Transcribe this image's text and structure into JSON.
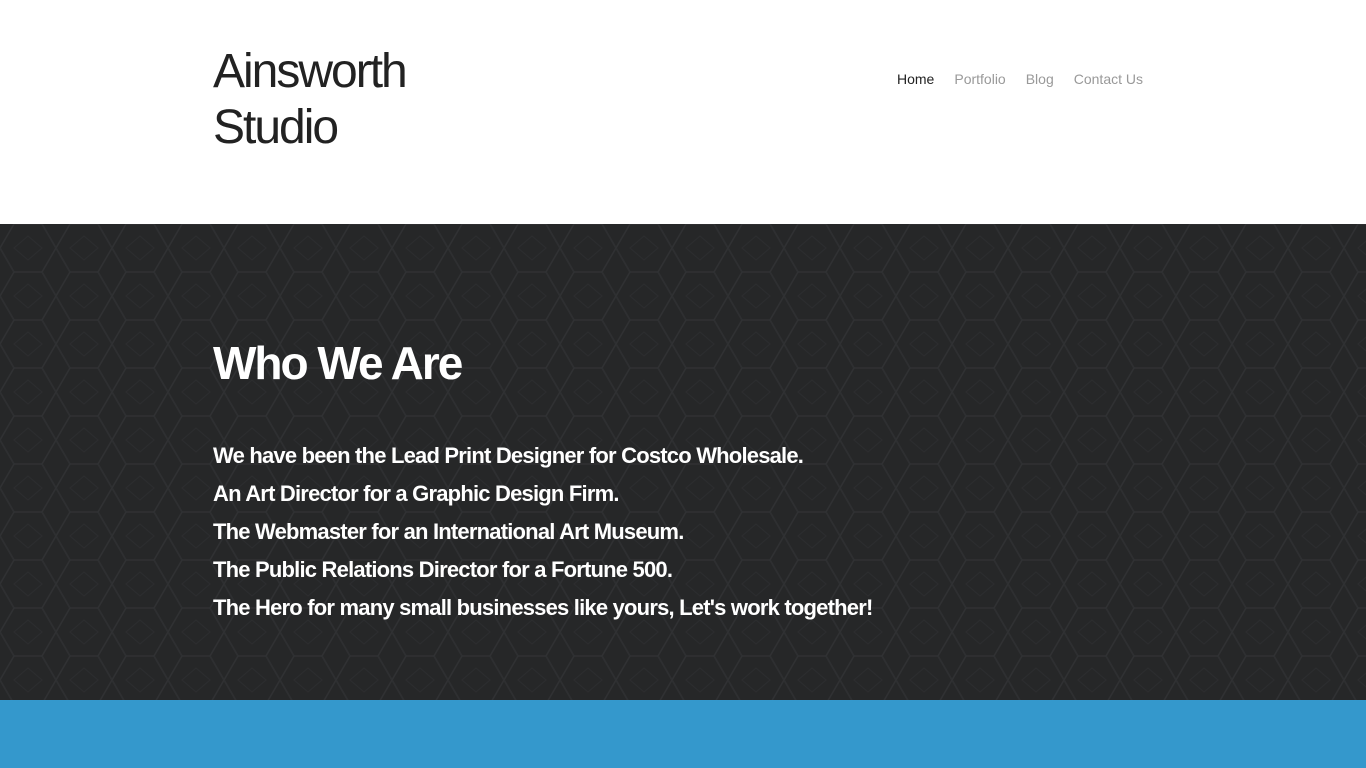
{
  "header": {
    "logo_line1": "Ainsworth",
    "logo_line2": "Studio",
    "nav": [
      {
        "label": "Home",
        "active": true
      },
      {
        "label": "Portfolio",
        "active": false
      },
      {
        "label": "Blog",
        "active": false
      },
      {
        "label": "Contact Us",
        "active": false
      }
    ]
  },
  "hero": {
    "title": "Who We Are",
    "lines": [
      "We have been the Lead Print Designer for Costco Wholesale.",
      "An Art Director for a Graphic Design Firm.",
      "The Webmaster for an International Art Museum.",
      "The Public Relations Director for a Fortune 500.",
      "The Hero for many small businesses like yours, Let's work together!"
    ]
  },
  "colors": {
    "hero_background": "#262728",
    "band": "#3498cc",
    "text_dark": "#222222",
    "nav_inactive": "#999999"
  }
}
